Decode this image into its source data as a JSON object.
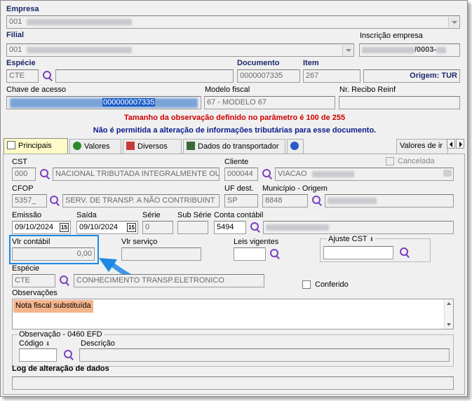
{
  "header": {
    "empresa_label": "Empresa",
    "empresa_code": "001",
    "filial_label": "Filial",
    "filial_code": "001",
    "inscricao_label": "Inscrição empresa",
    "inscricao_value": "/0003-",
    "especie_label": "Espécie",
    "especie_value": "CTE",
    "documento_label": "Documento",
    "documento_value": "0000007335",
    "item_label": "Item",
    "item_value": "267",
    "origem_label": "Origem: TUR",
    "chave_label": "Chave de acesso",
    "chave_value": "000000007335",
    "modelo_label": "Modelo fiscal",
    "modelo_value": "67 - MODELO 67",
    "recibo_label": "Nr. Recibo Reinf",
    "msg_red": "Tamanho da observação definido no parâmetro é 100 de 255",
    "msg_blue": "Não é permitida a alteração de informações tributárias para esse documento."
  },
  "tabs": [
    {
      "label": "Principais"
    },
    {
      "label": "Valores"
    },
    {
      "label": "Diversos"
    },
    {
      "label": "Dados do transportador"
    },
    {
      "label": "Valores de ir"
    }
  ],
  "main": {
    "cst_label": "CST",
    "cst_code": "000",
    "cst_desc": "NACIONAL TRIBUTADA INTEGRALMENTE OU",
    "cliente_label": "Cliente",
    "cliente_code": "000044",
    "cliente_name": "VIACAO",
    "cancelada_label": "Cancelada",
    "cfop_label": "CFOP",
    "cfop_code": "5357_",
    "cfop_desc": "SERV. DE TRANSP.  A NÃO CONTRIBUINT",
    "uf_label": "UF dest.",
    "uf_value": "SP",
    "municipio_label": "Município - Origem",
    "municipio_code": "8848",
    "emissao_label": "Emissão",
    "emissao_value": "09/10/2024",
    "saida_label": "Saída",
    "saida_value": "09/10/2024",
    "serie_label": "Série",
    "serie_value": "0",
    "subserie_label": "Sub Série",
    "conta_label": "Conta contábil",
    "conta_value": "5494",
    "vlr_contabil_label": "Vlr contábil",
    "vlr_contabil_value": "0,00",
    "vlr_servico_label": "Vlr serviço",
    "leis_label": "Leis vigentes",
    "ajuste_label": "Ajuste CST",
    "especie_label": "Espécie",
    "especie_code": "CTE",
    "especie_desc": "CONHECIMENTO TRANSP.ELETRONICO",
    "conferido_label": "Conferido",
    "obs_label": "Observações",
    "obs_value": "Nota fiscal substituída",
    "obs0460_label": "Observação - 0460 EFD",
    "codigo_label": "Código",
    "descricao_label": "Descrição",
    "log_label": "Log de alteração de dados"
  },
  "icons": {
    "search": "search-icon",
    "calendar": "calendar-icon",
    "dropdown": "chevron-down-icon"
  },
  "colors": {
    "label_blue": "#1a2a6a",
    "msg_red": "#d00000",
    "msg_blue": "#0a1a8a",
    "highlight_blue": "#1e88e5",
    "obs_bg": "#f4b48c",
    "active_tab": "#fffbc8"
  }
}
